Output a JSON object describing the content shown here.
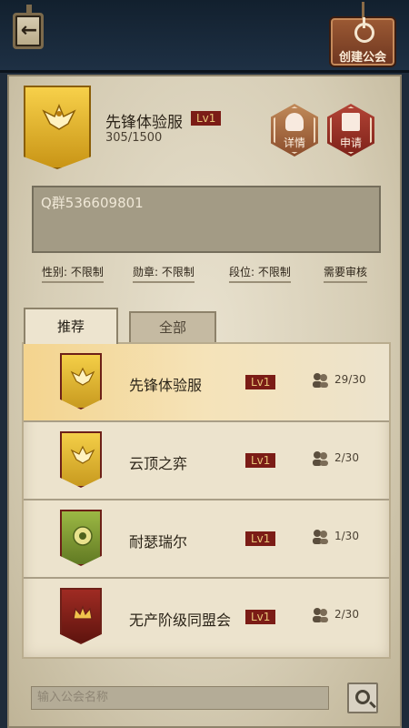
{
  "topbar": {
    "back_icon": "arrow-left-icon",
    "create_label": "创建公会"
  },
  "guild": {
    "name": "先锋体验服",
    "level": "Lv1",
    "members": "305/1500",
    "detail_label": "详情",
    "apply_label": "申请",
    "qq_text": "Q群536609801",
    "requirements": [
      "性别: 不限制",
      "勋章: 不限制",
      "段位: 不限制",
      "需要审核"
    ]
  },
  "tabs": [
    {
      "label": "推荐",
      "active": true
    },
    {
      "label": "全部",
      "active": false
    }
  ],
  "list": [
    {
      "name": "先锋体验服",
      "level": "Lv1",
      "members": "29/30",
      "color": "gold",
      "mark": "phoenix"
    },
    {
      "name": "云顶之弈",
      "level": "Lv1",
      "members": "2/30",
      "color": "gold",
      "mark": "phoenix"
    },
    {
      "name": "耐瑟瑞尔",
      "level": "Lv1",
      "members": "1/30",
      "color": "green",
      "mark": "eye"
    },
    {
      "name": "无产阶级同盟会",
      "level": "Lv1",
      "members": "2/30",
      "color": "red",
      "mark": "crown"
    }
  ],
  "search": {
    "placeholder": "输入公会名称"
  }
}
